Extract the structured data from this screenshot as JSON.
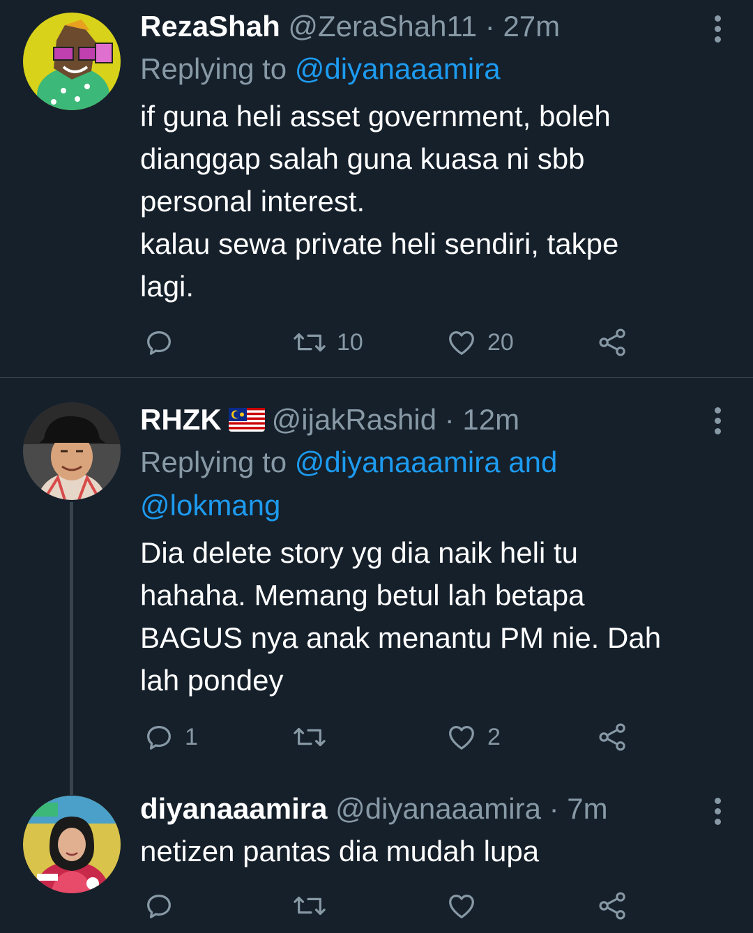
{
  "tweets": [
    {
      "display_name": "RezaShah",
      "handle": "@ZeraShah11",
      "separator": "·",
      "time": "27m",
      "replying_prefix": "Replying to ",
      "replying_to": "@diyanaaamira",
      "replying_to_line2": "",
      "body": "if guna heli asset government, boleh\ndianggap salah guna kuasa ni sbb\npersonal interest.\nkalau sewa private heli sendiri, takpe\nlagi.",
      "reply_count": "",
      "retweet_count": "10",
      "like_count": "20"
    },
    {
      "display_name": "RHZK",
      "handle": "@ijakRashid",
      "separator": "·",
      "time": "12m",
      "replying_prefix": "Replying to ",
      "replying_to": "@diyanaaamira and",
      "replying_to_line2": "@lokmang",
      "body": "Dia delete story yg dia naik heli tu\nhahaha. Memang betul lah betapa\nBAGUS nya anak menantu PM nie. Dah\nlah pondey",
      "reply_count": "1",
      "retweet_count": "",
      "like_count": "2"
    },
    {
      "display_name": "diyanaaamira",
      "handle": "@diyanaaamira",
      "separator": "·",
      "time": "7m",
      "body": "netizen pantas dia mudah lupa",
      "reply_count": "",
      "retweet_count": "",
      "like_count": ""
    }
  ],
  "icons": {
    "reply": "speech-bubble-icon",
    "retweet": "retweet-arrows-icon",
    "like": "heart-icon",
    "share": "share-nodes-icon",
    "more": "vertical-dots-icon",
    "flag": "malaysia-flag-icon"
  },
  "colors": {
    "background": "#15202b",
    "muted_text": "#8899a6",
    "mention": "#1d9bf0",
    "divider": "#38444d"
  }
}
